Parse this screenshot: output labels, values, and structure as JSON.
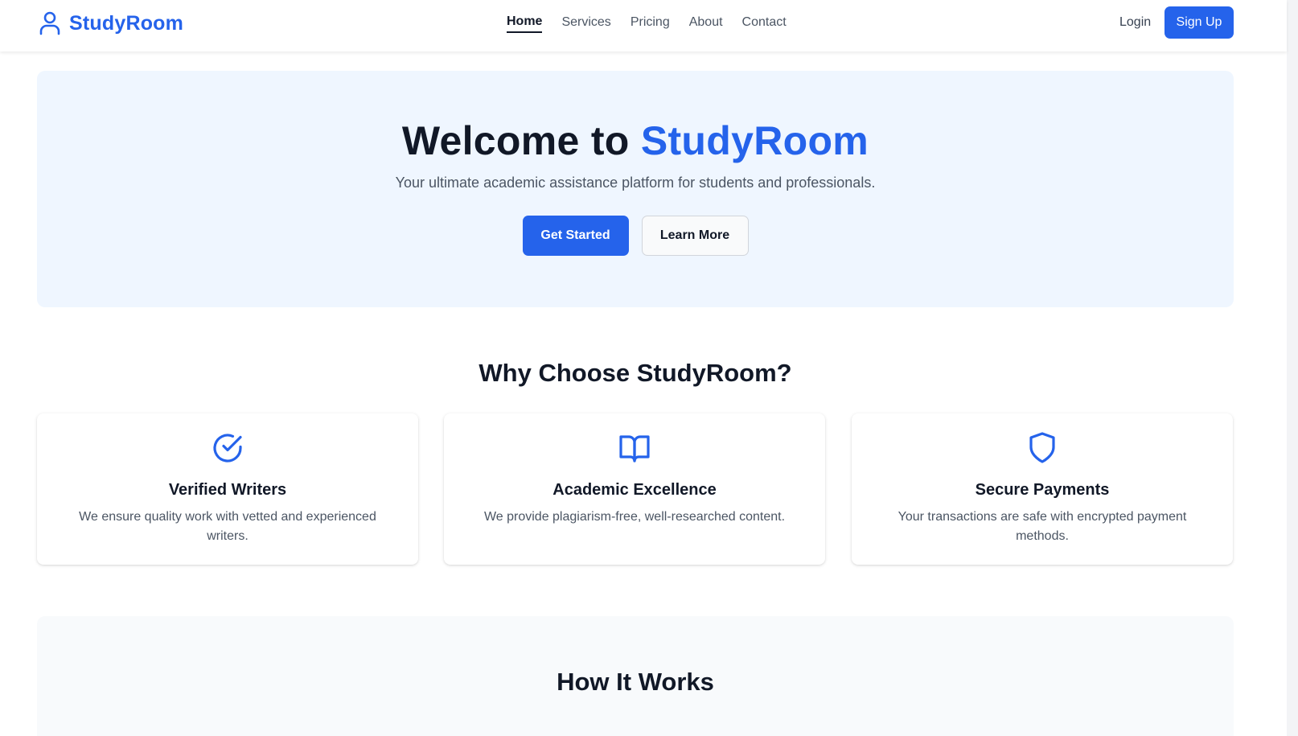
{
  "header": {
    "brand": "StudyRoom",
    "nav": [
      "Home",
      "Services",
      "Pricing",
      "About",
      "Contact"
    ],
    "active_nav": "Home",
    "login": "Login",
    "signup": "Sign Up"
  },
  "hero": {
    "title_prefix": "Welcome to ",
    "title_accent": "StudyRoom",
    "subtitle": "Your ultimate academic assistance platform for students and professionals.",
    "primary_button": "Get Started",
    "secondary_button": "Learn More"
  },
  "features": {
    "title": "Why Choose StudyRoom?",
    "cards": [
      {
        "icon": "check-circle-icon",
        "title": "Verified Writers",
        "description": "We ensure quality work with vetted and experienced writers."
      },
      {
        "icon": "book-open-icon",
        "title": "Academic Excellence",
        "description": "We provide plagiarism-free, well-researched content."
      },
      {
        "icon": "shield-icon",
        "title": "Secure Payments",
        "description": "Your transactions are safe with encrypted payment methods."
      }
    ]
  },
  "how_it_works": {
    "title": "How It Works"
  },
  "colors": {
    "accent": "#2563eb",
    "hero_bg": "#eff6ff",
    "section_bg": "#f8fafc",
    "text_dark": "#111827",
    "text_muted": "#4b5563"
  }
}
